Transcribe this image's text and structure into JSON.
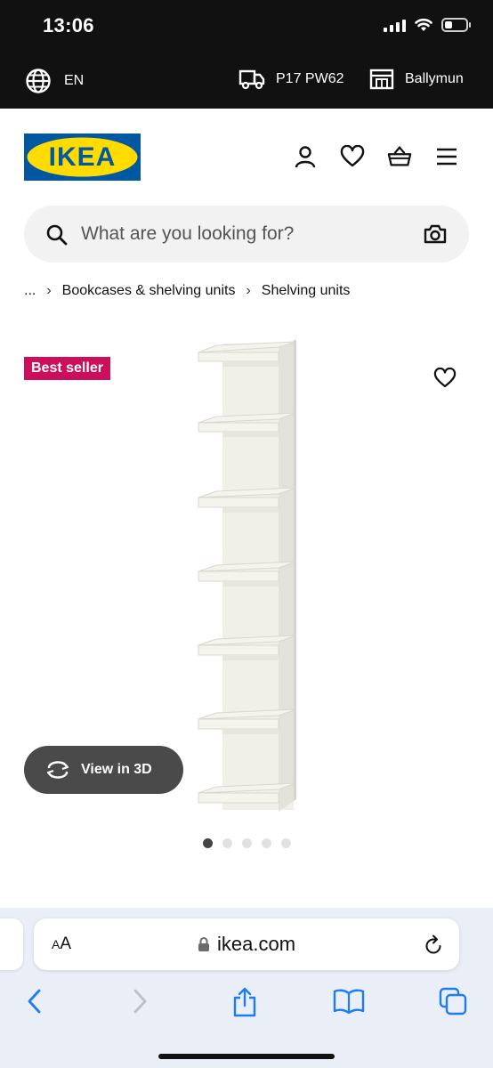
{
  "status": {
    "time": "13:06"
  },
  "util": {
    "language": "EN",
    "postcode": "P17 PW62",
    "store": "Ballymun",
    "globe_icon": "globe-icon",
    "truck_icon": "delivery-truck-icon",
    "store_icon": "store-icon"
  },
  "header": {
    "logo_text": "IKEA",
    "brand_blue": "#0058A3",
    "brand_yellow": "#FFDB00",
    "icons": [
      "account-icon",
      "heart-icon",
      "basket-icon",
      "menu-icon"
    ]
  },
  "search": {
    "placeholder": "What are you looking for?",
    "icon": "search-icon",
    "camera_icon": "camera-icon"
  },
  "breadcrumb": {
    "ellipsis": "...",
    "items": [
      "Bookcases & shelving units",
      "Shelving units"
    ]
  },
  "product": {
    "badge": "Best seller",
    "badge_color": "#CC0F5A",
    "view3d_label": "View in 3D",
    "image_count": 5,
    "active_image": 1
  },
  "browser": {
    "aa_label": "AA",
    "domain": "ikea.com",
    "accent": "#1E7CF2"
  }
}
